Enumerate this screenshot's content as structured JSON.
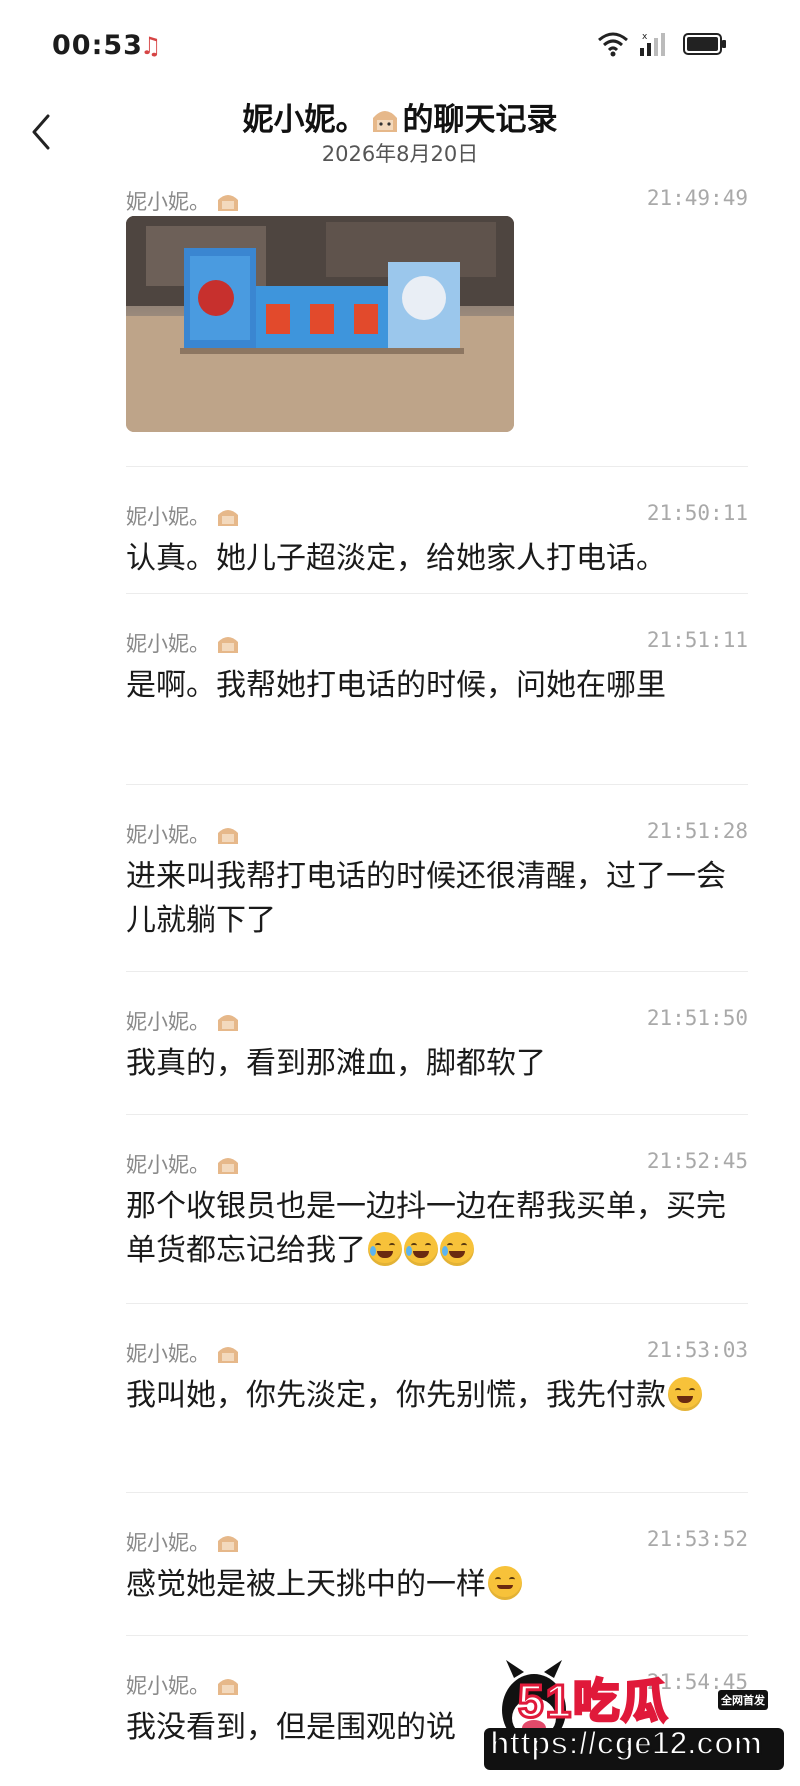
{
  "status_bar": {
    "time": "00:53"
  },
  "header": {
    "title_name": "妮小妮。",
    "title_suffix": "的聊天记录",
    "date": "2026年8月20日"
  },
  "messages": [
    {
      "sender": "妮小妮。",
      "time": "21:49:49",
      "type": "image"
    },
    {
      "sender": "妮小妮。",
      "time": "21:50:11",
      "text": "认真。她儿子超淡定，给她家人打电话。"
    },
    {
      "sender": "妮小妮。",
      "time": "21:51:11",
      "text": "是啊。我帮她打电话的时候，问她在哪里"
    },
    {
      "sender": "妮小妮。",
      "time": "21:51:28",
      "text": "进来叫我帮打电话的时候还很清醒，过了一会儿就躺下了"
    },
    {
      "sender": "妮小妮。",
      "time": "21:51:50",
      "text": "我真的，看到那滩血，脚都软了"
    },
    {
      "sender": "妮小妮。",
      "time": "21:52:45",
      "text": "那个收银员也是一边抖一边在帮我买单，买完单货都忘记给我了",
      "emojis": [
        "crying-laugh",
        "crying-laugh",
        "crying-laugh"
      ]
    },
    {
      "sender": "妮小妮。",
      "time": "21:53:03",
      "text": "我叫她，你先淡定，你先别慌，我先付款",
      "emojis": [
        "grin"
      ]
    },
    {
      "sender": "妮小妮。",
      "time": "21:53:52",
      "text": "感觉她是被上天挑中的一样",
      "emojis": [
        "smile"
      ]
    },
    {
      "sender": "妮小妮。",
      "time": "21:54:45",
      "text": "我没看到，但是围观的说"
    }
  ],
  "watermark": {
    "brand": "51吃瓜",
    "tag": "全网首发",
    "url": "https://cge12.com"
  },
  "colors": {
    "accent_red": "#e0193a",
    "text": "#1a1a1a",
    "meta": "#8a8a8a"
  }
}
